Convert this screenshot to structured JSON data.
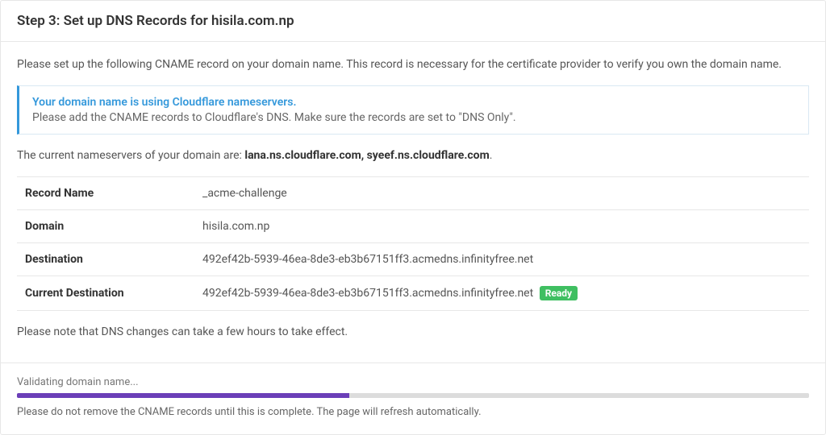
{
  "header": {
    "title": "Step 3: Set up DNS Records for hisila.com.np"
  },
  "intro": "Please set up the following CNAME record on your domain name. This record is necessary for the certificate provider to verify you own the domain name.",
  "alert": {
    "title": "Your domain name is using Cloudflare nameservers.",
    "text": "Please add the CNAME records to Cloudflare's DNS. Make sure the records are set to \"DNS Only\"."
  },
  "nameservers": {
    "prefix": "The current nameservers of your domain are: ",
    "list": "lana.ns.cloudflare.com, syeef.ns.cloudflare.com",
    "suffix": "."
  },
  "table": {
    "record_name_label": "Record Name",
    "record_name_value": "_acme-challenge",
    "domain_label": "Domain",
    "domain_value": "hisila.com.np",
    "destination_label": "Destination",
    "destination_value": "492ef42b-5939-46ea-8de3-eb3b67151ff3.acmedns.infinityfree.net",
    "current_destination_label": "Current Destination",
    "current_destination_value": "492ef42b-5939-46ea-8de3-eb3b67151ff3.acmedns.infinityfree.net",
    "ready_badge": "Ready"
  },
  "note": "Please note that DNS changes can take a few hours to take effect.",
  "footer": {
    "validating": "Validating domain name...",
    "progress_percent": 42,
    "note": "Please do not remove the CNAME records until this is complete. The page will refresh automatically."
  }
}
